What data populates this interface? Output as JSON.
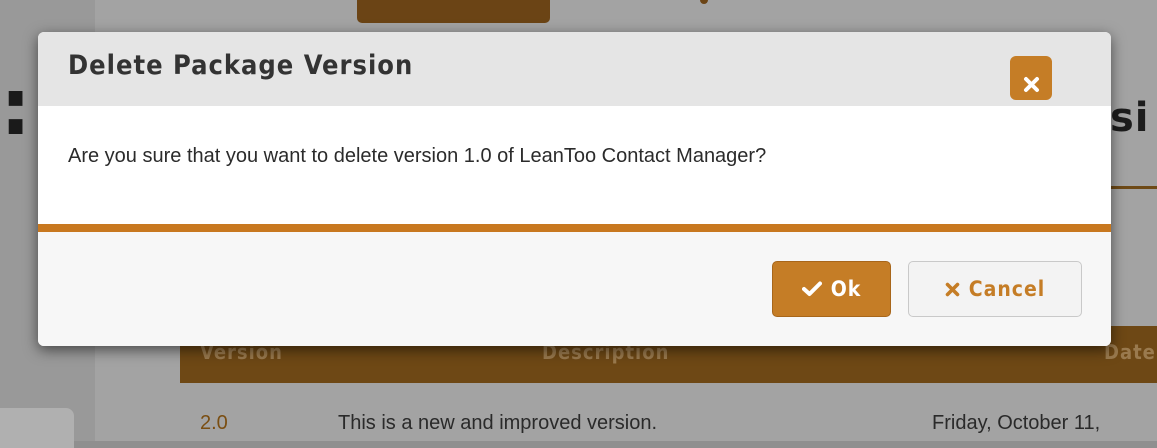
{
  "dialog": {
    "title": "Delete Package Version",
    "message": "Are you sure that you want to delete version 1.0 of LeanToo Contact Manager?",
    "ok_label": "Ok",
    "cancel_label": "Cancel",
    "close_icon": "close-icon",
    "ok_icon": "checkmark-icon",
    "cancel_icon": "x-icon"
  },
  "background": {
    "heading_fragment": "si",
    "table": {
      "headers": [
        "Version",
        "Description",
        "Date"
      ],
      "rows": [
        {
          "version": "2.0",
          "description": "This is a new and improved version.",
          "date": "Friday, October 11,"
        }
      ]
    }
  },
  "colors": {
    "accent": "#c57d26",
    "header_bg": "#e5e5e5",
    "footer_bg": "#f7f7f7"
  }
}
